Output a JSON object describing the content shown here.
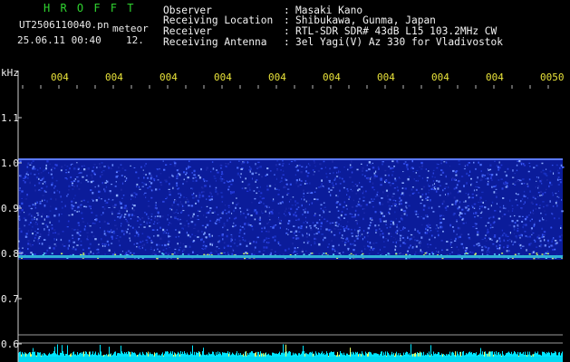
{
  "header": {
    "title": "H R O F F T",
    "file_name": "UT2506110040.pn",
    "meteor_label": "meteor",
    "datetime": "25.06.11 00:40",
    "count": "12."
  },
  "info": {
    "observer_label": "Observer",
    "observer_value": "Masaki Kano",
    "location_label": "Receiving Location",
    "location_value": "Shibukawa, Gunma, Japan",
    "receiver_label": "Receiver",
    "receiver_value": "RTL-SDR SDR# 43dB L15 103.2MHz CW",
    "antenna_label": "Receiving Antenna",
    "antenna_value": "3el Yagi(V) Az 330 for Vladivostok",
    "colon": ":"
  },
  "axis": {
    "unit": "kHz",
    "y_labels": [
      "1.1",
      "1.0",
      "0.9",
      "0.8",
      "0.7",
      "0.6"
    ],
    "time_labels": [
      "004",
      "004",
      "004",
      "004",
      "004",
      "004",
      "004",
      "004",
      "004",
      "0050"
    ]
  },
  "colors": {
    "background": "#000000",
    "title": "#2fd32f",
    "time_labels": "#e8e23a",
    "spectrum_blue": "#1a2ab4",
    "bottom_band": "#00e5ff"
  }
}
